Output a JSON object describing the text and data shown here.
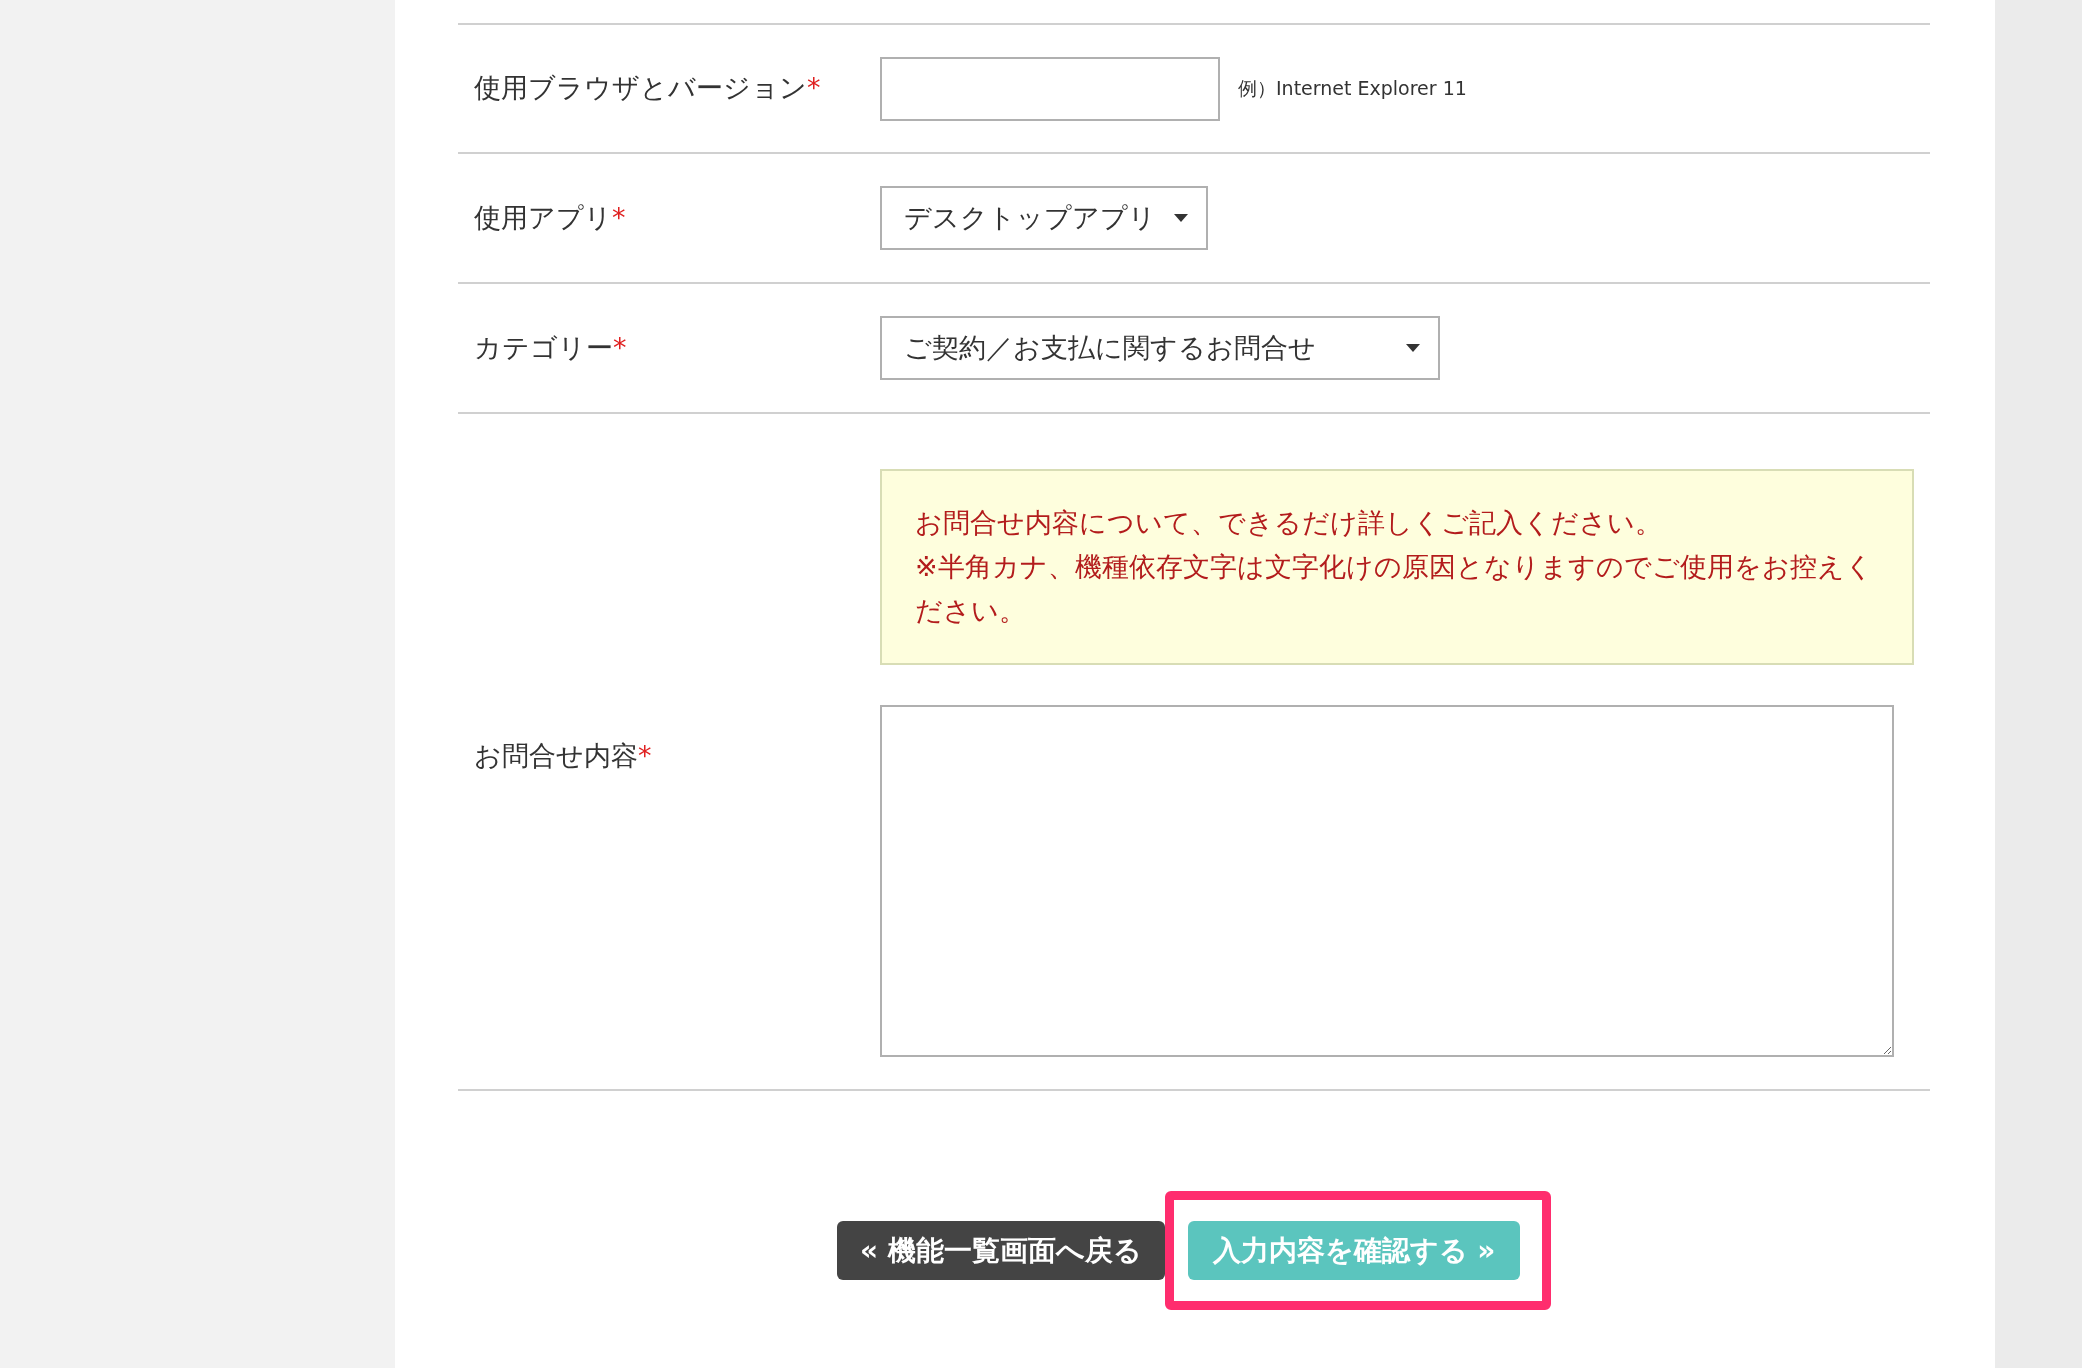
{
  "fields": [
    {
      "kind": "text",
      "label": "使用ブラウザとバージョン",
      "required_mark": "*",
      "hint": "例）Internet Explorer 11"
    },
    {
      "kind": "select",
      "label": "使用アプリ",
      "required_mark": "*",
      "value": "デスクトップアプリ"
    },
    {
      "kind": "select",
      "label": "カテゴリー",
      "required_mark": "*",
      "value": "ご契約／お支払に関するお問合せ"
    },
    {
      "kind": "textarea",
      "label": "お問合せ内容",
      "required_mark": "*",
      "notice": [
        "お問合せ内容について、できるだけ詳しくご記入ください。",
        "※半角カナ、機種依存文字は文字化けの原因となりますのでご使用をお控えください。"
      ]
    }
  ],
  "buttons": [
    {
      "kind": "back",
      "label": "« 機能一覧画面へ戻る",
      "highlighted": false
    },
    {
      "kind": "confirm",
      "label": "入力内容を確認する »",
      "highlighted": true
    }
  ]
}
